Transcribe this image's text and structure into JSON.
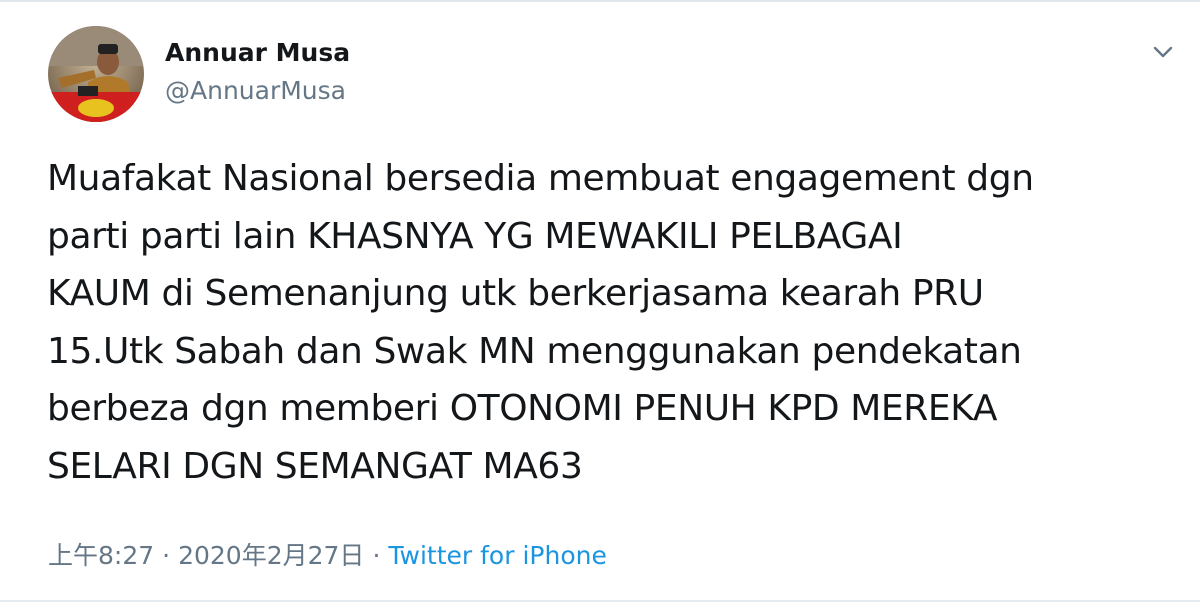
{
  "tweet": {
    "author": {
      "display_name": "Annuar Musa",
      "handle": "@AnnuarMusa"
    },
    "text_lines": [
      "Muafakat Nasional bersedia membuat engagement dgn",
      "parti parti lain KHASNYA YG MEWAKILI PELBAGAI",
      "KAUM di Semenanjung utk berkerjasama kearah PRU",
      "15.Utk Sabah dan Swak MN menggunakan pendekatan",
      "berbeza dgn memberi OTONOMI PENUH KPD MEREKA",
      "SELARI DGN SEMANGAT MA63"
    ],
    "time": "上午8:27",
    "date": "2020年2月27日",
    "separator": "·",
    "source": "Twitter for iPhone"
  },
  "icons": {
    "menu": "chevron-down-icon",
    "avatar": "avatar"
  },
  "colors": {
    "text": "#14171a",
    "secondary": "#657786",
    "link": "#1b95e0",
    "border": "#e1e8ed"
  }
}
